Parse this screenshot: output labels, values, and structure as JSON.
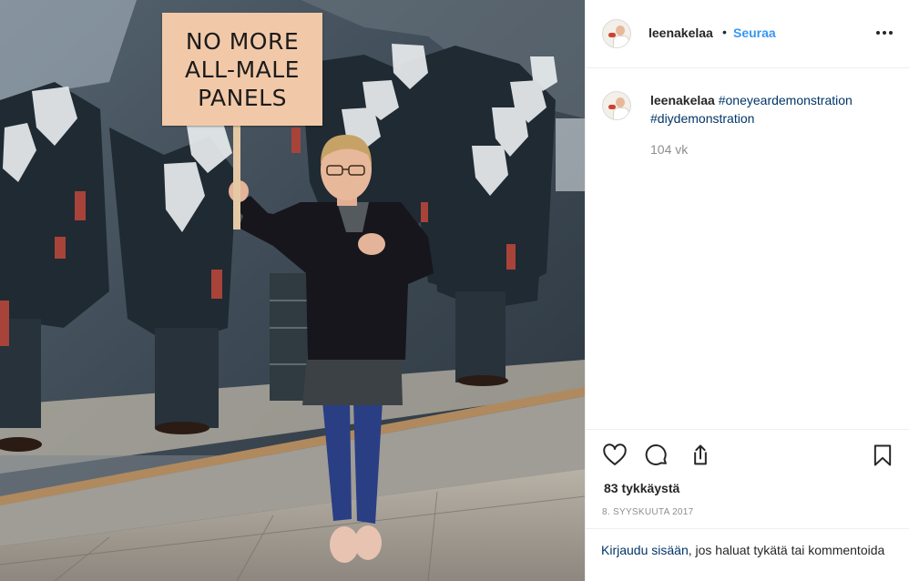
{
  "post": {
    "sign_lines": [
      "NO MORE",
      "ALL-MALE",
      "PANELS"
    ]
  },
  "header": {
    "username": "leenakelaa",
    "separator": "•",
    "follow_label": "Seuraa"
  },
  "caption": {
    "username": "leenakelaa",
    "hashtags": [
      "#oneyeardemonstration",
      "#diydemonstration"
    ],
    "time_ago": "104 vk"
  },
  "actions": {
    "icons": [
      "heart-icon",
      "comment-icon",
      "share-icon",
      "bookmark-icon"
    ]
  },
  "likes": "83 tykkäystä",
  "date": "8. SYYSKUUTA 2017",
  "login": {
    "link": "Kirjaudu sisään",
    "rest": ", jos haluat tykätä tai kommentoida"
  },
  "colors": {
    "link_blue": "#3897f0",
    "hashtag_blue": "#003569",
    "muted": "#8e8e8e",
    "text": "#262626",
    "divider": "#efefef"
  }
}
